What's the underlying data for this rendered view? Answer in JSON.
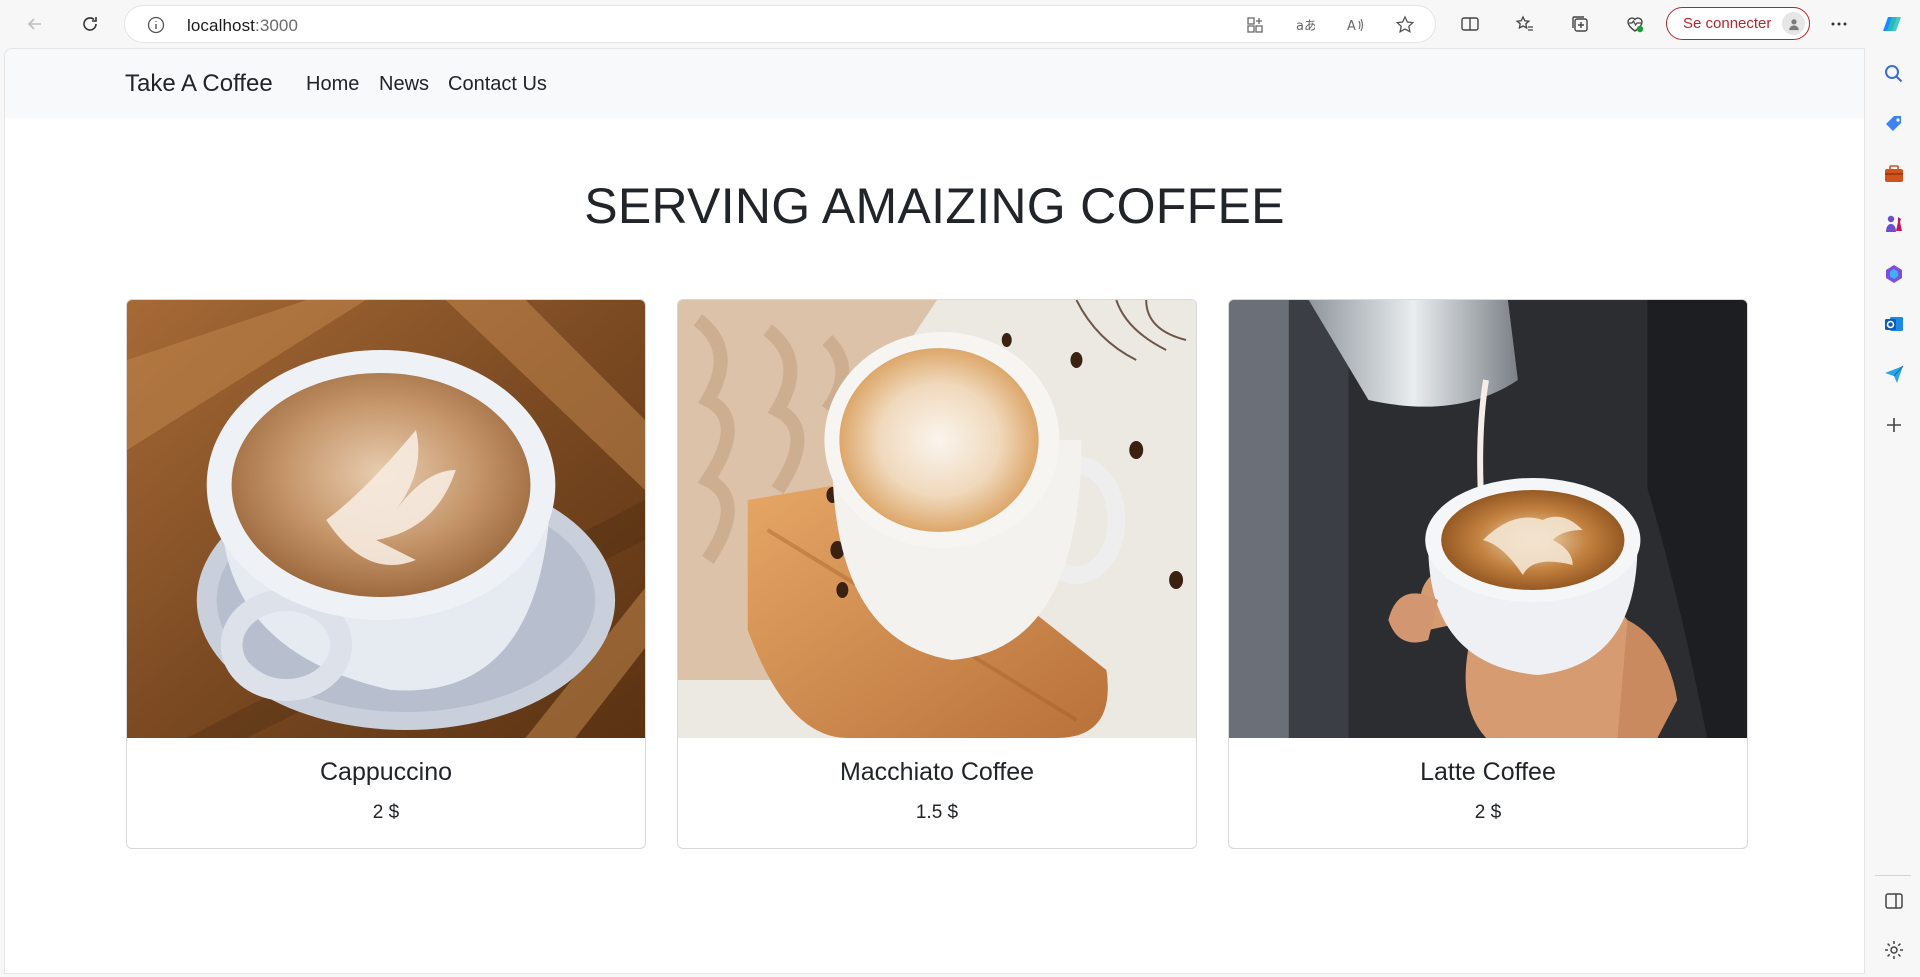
{
  "browser": {
    "url_host": "localhost",
    "url_port": ":3000",
    "signin_label": "Se connecter"
  },
  "site": {
    "brand": "Take A Coffee",
    "nav": [
      {
        "label": "Home"
      },
      {
        "label": "News"
      },
      {
        "label": "Contact Us"
      }
    ],
    "hero_title": "SERVING AMAIZING COFFEE",
    "products": [
      {
        "name": "Cappuccino",
        "price": "2 $",
        "image": "cappuccino-photo"
      },
      {
        "name": "Macchiato Coffee",
        "price": "1.5 $",
        "image": "macchiato-photo"
      },
      {
        "name": "Latte Coffee",
        "price": "2 $",
        "image": "latte-photo"
      }
    ]
  },
  "colors": {
    "accent_signin": "#b4262c",
    "nav_bg": "#f8f9fa",
    "text": "#212529"
  }
}
